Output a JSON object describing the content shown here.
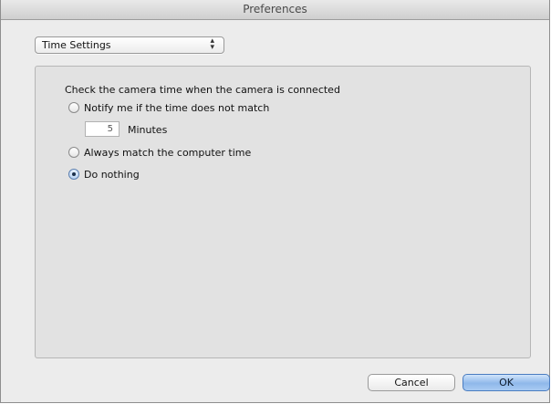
{
  "window": {
    "title": "Preferences"
  },
  "settings_popup": {
    "selected": "Time Settings",
    "arrows_glyph": "⌃⌄"
  },
  "time_panel": {
    "heading": "Check the camera time when the camera is connected",
    "options": [
      {
        "label": "Notify me if the time does not match",
        "checked": false
      },
      {
        "label": "Always match the computer time",
        "checked": false
      },
      {
        "label": "Do nothing",
        "checked": true
      }
    ],
    "minutes_value": "5",
    "minutes_label": "Minutes"
  },
  "buttons": {
    "cancel_label": "Cancel",
    "ok_label": "OK"
  },
  "colors": {
    "accent": "#8fb8ea",
    "window_bg": "#ececec",
    "panel_bg": "#e2e2e2"
  }
}
